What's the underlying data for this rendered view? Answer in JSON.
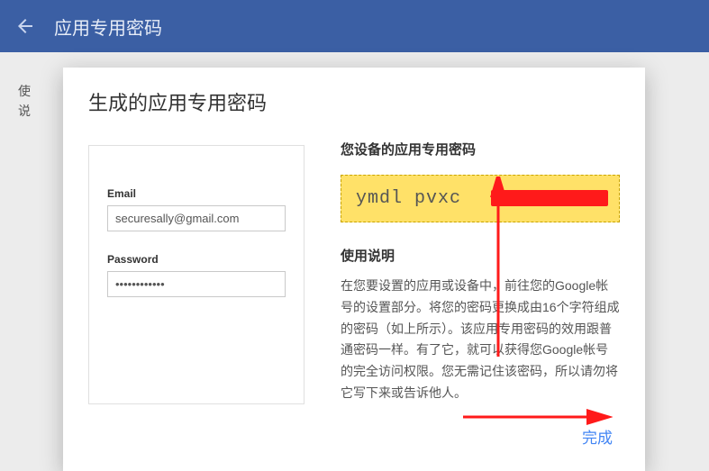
{
  "appbar": {
    "title": "应用专用密码"
  },
  "modal": {
    "title": "生成的应用专用密码",
    "device_heading": "您设备的应用专用密码",
    "generated_password": "ymdl pvxc",
    "instructions_heading": "使用说明",
    "instructions_body": "在您要设置的应用或设备中，前往您的Google帐号的设置部分。将您的密码更换成由16个字符组成的密码（如上所示）。该应用专用密码的效用跟普通密码一样。有了它，就可以获得您Google帐号的完全访问权限。您无需记住该密码，所以请勿将它写下来或告诉他人。",
    "done_label": "完成"
  },
  "form": {
    "email_label": "Email",
    "email_value": "securesally@gmail.com",
    "password_label": "Password",
    "password_value": "••••••••••••"
  },
  "bg_line1": "使",
  "bg_line2": "说"
}
